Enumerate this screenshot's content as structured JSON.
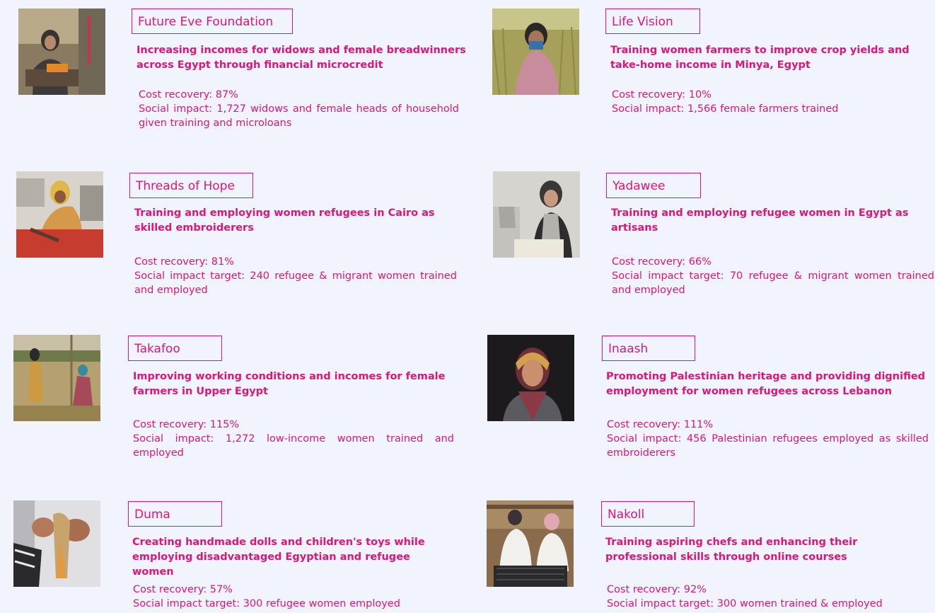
{
  "projects": [
    {
      "name": "Future Eve Foundation",
      "description": "Increasing incomes for widows and female breadwinners across Egypt through financial microcredit",
      "cost_recovery": "Cost recovery: 87%",
      "social_impact": "Social impact: 1,727 widows and female heads of household  given training and microloans"
    },
    {
      "name": "Life Vision",
      "description": "Training women farmers to improve crop yields and take-home income in Minya, Egypt",
      "cost_recovery": "Cost recovery: 10%",
      "social_impact": "Social impact: 1,566 female farmers trained"
    },
    {
      "name": "Threads of Hope",
      "description": "Training and employing women refugees in Cairo as skilled embroiderers",
      "cost_recovery": "Cost recovery: 81%",
      "social_impact": "Social impact target: 240 refugee & migrant women trained and employed"
    },
    {
      "name": "Yadawee",
      "description": "Training and employing refugee women in Egypt as artisans",
      "cost_recovery": "Cost recovery: 66%",
      "social_impact": "Social impact target: 70 refugee & migrant women trained and employed"
    },
    {
      "name": "Takafoo",
      "description": "Improving working conditions and incomes for female farmers in Upper Egypt",
      "cost_recovery": "Cost recovery: 115%",
      "social_impact": "Social impact: 1,272 low-income women trained and employed"
    },
    {
      "name": "Inaash",
      "description": "Promoting Palestinian heritage and providing dignified employment for women refugees across Lebanon",
      "cost_recovery": "Cost recovery: 111%",
      "social_impact": "Social impact: 456 Palestinian refugees employed as skilled embroiderers"
    },
    {
      "name": "Duma",
      "description": "Creating handmade dolls and children's toys while employing disadvantaged Egyptian and refugee women",
      "cost_recovery": "Cost recovery: 57%",
      "social_impact": "Social impact target: 300 refugee women employed"
    },
    {
      "name": "Nakoll",
      "description": "Training aspiring chefs and enhancing their professional skills through online courses",
      "cost_recovery": "Cost recovery: 92%",
      "social_impact": "Social impact target: 300 women trained & employed"
    }
  ],
  "colors": {
    "accent": "#e0157a",
    "background": "#f1f4fc"
  }
}
